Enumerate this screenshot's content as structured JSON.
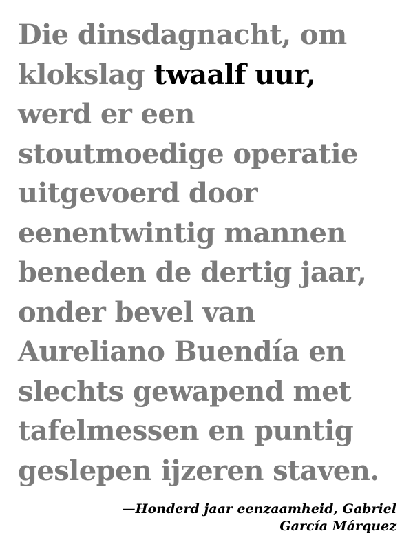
{
  "quote": {
    "line1": "Die dinsdagnacht, om",
    "line2_pre": "klokslag ",
    "line2_emph": "twaalf uur,",
    "line3": "werd er een",
    "line4": "stoutmoedige operatie",
    "line5": "uitgevoerd door",
    "line6": "eenentwintig mannen",
    "line7": "beneden de dertig jaar,",
    "line8": "onder bevel van",
    "line9": "Aureliano Buendía en",
    "line10": "slechts gewapend met",
    "line11": "tafelmessen en puntig",
    "line12": "geslepen ijzeren staven."
  },
  "attribution": {
    "line1": "—Honderd jaar eenzaamheid, Gabriel",
    "line2": "García Márquez"
  },
  "colors": {
    "quote_text": "#7b7b7b",
    "emphasis": "#000000",
    "attribution": "#000000",
    "background": "#ffffff"
  }
}
